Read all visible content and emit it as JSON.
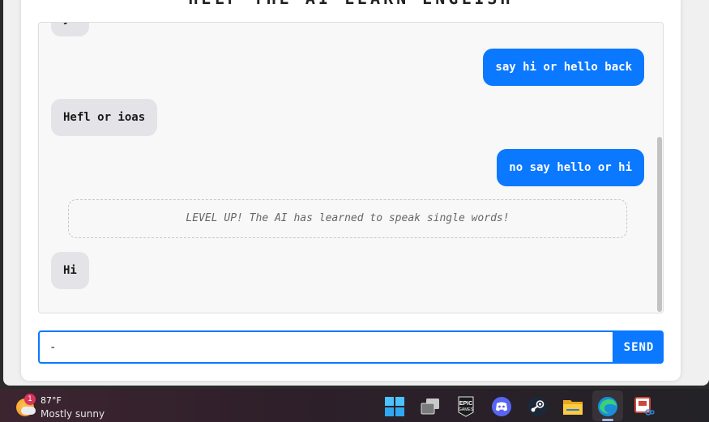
{
  "page": {
    "title": "HELP THE AI LEARN ENGLISH"
  },
  "chat": {
    "messages": [
      {
        "role": "ai",
        "text": "ya"
      },
      {
        "role": "user",
        "text": "say hi or hello back"
      },
      {
        "role": "ai",
        "text": "Hefl or ioas"
      },
      {
        "role": "user",
        "text": "no say hello or hi"
      },
      {
        "role": "system",
        "text": "LEVEL UP! The AI has learned to speak single words!"
      },
      {
        "role": "ai",
        "text": "Hi"
      }
    ]
  },
  "composer": {
    "input_value": "-",
    "send_label": "SEND"
  },
  "taskbar": {
    "weather": {
      "badge": "1",
      "temperature": "87°F",
      "condition": "Mostly sunny"
    },
    "apps": [
      {
        "name": "start",
        "icon": "windows-start-icon"
      },
      {
        "name": "task-view",
        "icon": "task-view-icon"
      },
      {
        "name": "epic-games",
        "icon": "epic-games-icon",
        "label": "EPIC GAMES"
      },
      {
        "name": "discord",
        "icon": "discord-icon"
      },
      {
        "name": "steam",
        "icon": "steam-icon"
      },
      {
        "name": "file-explorer",
        "icon": "folder-icon"
      },
      {
        "name": "edge",
        "icon": "edge-icon",
        "active": true
      },
      {
        "name": "snipping-tool",
        "icon": "snipping-tool-icon"
      }
    ]
  },
  "colors": {
    "accent": "#0a78ff",
    "ai_bubble": "#e4e4e8",
    "chat_bg": "#f8f8f8",
    "badge": "#d9345c"
  }
}
